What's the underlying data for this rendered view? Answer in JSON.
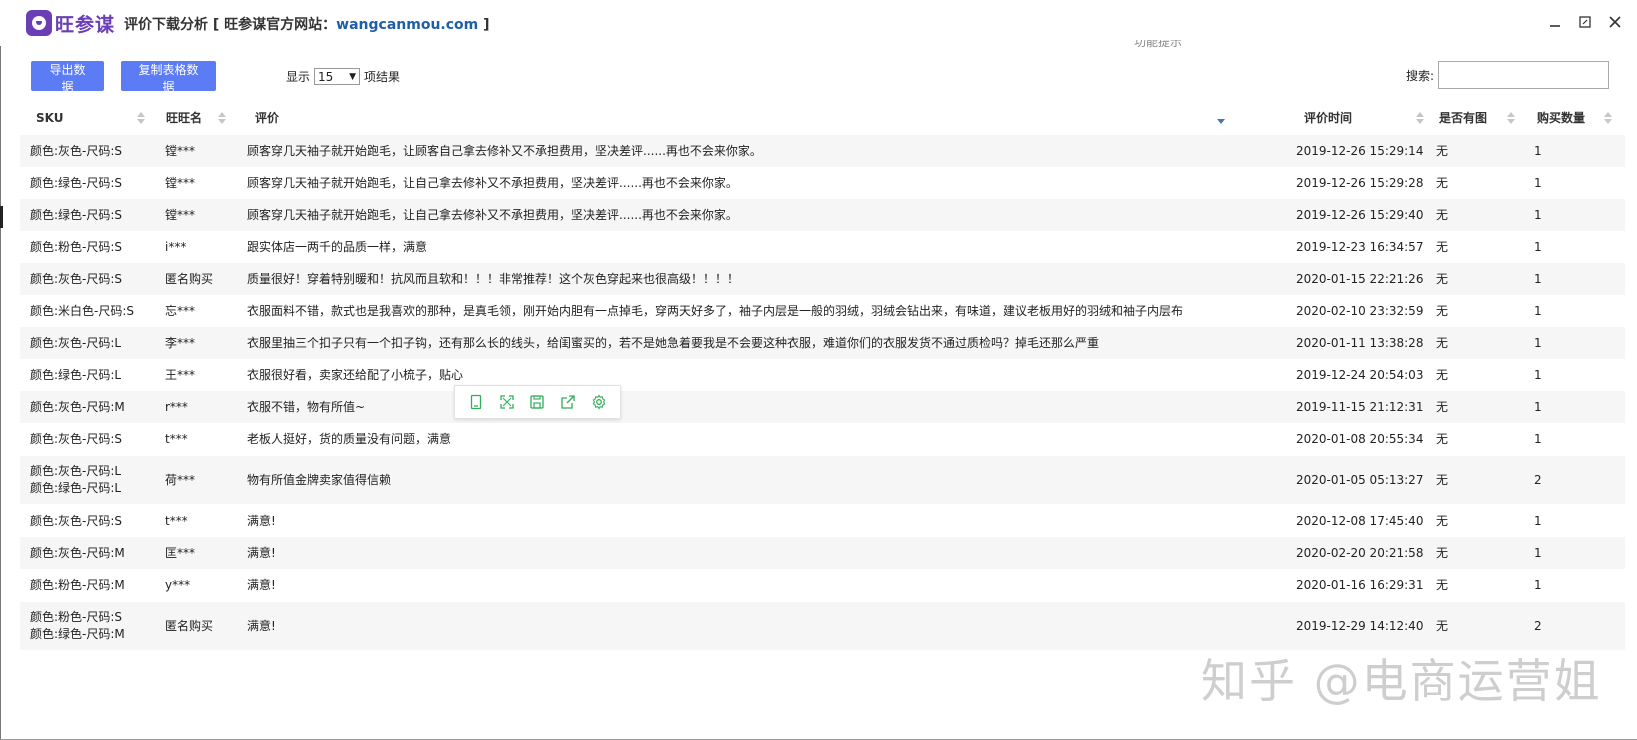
{
  "app": {
    "brand": "旺参谋",
    "title": "评价下载分析",
    "site_prefix": "[ 旺参谋官方网站：",
    "site_url": "wangcanmou.com",
    "site_suffix": " ]"
  },
  "hint": "功能提示",
  "toolbar": {
    "export_label": "导出数据",
    "copy_label": "复制表格数据",
    "show_label": "显示",
    "page_size": "15",
    "results_label": "项结果",
    "search_label": "搜索:"
  },
  "table": {
    "headers": {
      "sku": "SKU",
      "name": "旺旺名",
      "review": "评价",
      "time": "评价时间",
      "pic": "是否有图",
      "qty": "购买数量"
    },
    "rows": [
      {
        "sku": [
          "颜色:灰色-尺码:S"
        ],
        "name": "镗***",
        "review": "顾客穿几天袖子就开始跑毛，让顾客自己拿去修补又不承担费用，坚决差评......再也不会来你家。",
        "time": "2019-12-26 15:29:14",
        "pic": "无",
        "qty": "1"
      },
      {
        "sku": [
          "颜色:绿色-尺码:S"
        ],
        "name": "镗***",
        "review": "顾客穿几天袖子就开始跑毛，让自己拿去修补又不承担费用，坚决差评......再也不会来你家。",
        "time": "2019-12-26 15:29:28",
        "pic": "无",
        "qty": "1"
      },
      {
        "sku": [
          "颜色:绿色-尺码:S"
        ],
        "name": "镗***",
        "review": "顾客穿几天袖子就开始跑毛，让自己拿去修补又不承担费用，坚决差评......再也不会来你家。",
        "time": "2019-12-26 15:29:40",
        "pic": "无",
        "qty": "1"
      },
      {
        "sku": [
          "颜色:粉色-尺码:S"
        ],
        "name": "i***",
        "review": "跟实体店一两千的品质一样，满意",
        "time": "2019-12-23 16:34:57",
        "pic": "无",
        "qty": "1"
      },
      {
        "sku": [
          "颜色:灰色-尺码:S"
        ],
        "name": "匿名购买",
        "review": "质量很好！穿着特别暖和！抗风而且软和！！！非常推荐！这个灰色穿起来也很高级！！！！",
        "time": "2020-01-15 22:21:26",
        "pic": "无",
        "qty": "1"
      },
      {
        "sku": [
          "颜色:米白色-尺码:S"
        ],
        "name": "忘***",
        "review": "衣服面料不错，款式也是我喜欢的那种，是真毛领，刚开始内胆有一点掉毛，穿两天好多了，袖子内层是一般的羽绒，羽绒会钻出来，有味道，建议老板用好的羽绒和袖子内层布",
        "time": "2020-02-10 23:32:59",
        "pic": "无",
        "qty": "1"
      },
      {
        "sku": [
          "颜色:灰色-尺码:L"
        ],
        "name": "李***",
        "review": "衣服里抽三个扣子只有一个扣子钩，还有那么长的线头，给闺蜜买的，若不是她急着要我是不会要这种衣服，难道你们的衣服发货不通过质检吗？掉毛还那么严重",
        "time": "2020-01-11 13:38:28",
        "pic": "无",
        "qty": "1"
      },
      {
        "sku": [
          "颜色:绿色-尺码:L"
        ],
        "name": "王***",
        "review": "衣服很好看，卖家还给配了小梳子，贴心",
        "time": "2019-12-24 20:54:03",
        "pic": "无",
        "qty": "1"
      },
      {
        "sku": [
          "颜色:灰色-尺码:M"
        ],
        "name": "r***",
        "review": "衣服不错，物有所值~",
        "time": "2019-11-15 21:12:31",
        "pic": "无",
        "qty": "1"
      },
      {
        "sku": [
          "颜色:灰色-尺码:S"
        ],
        "name": "t***",
        "review": "老板人挺好，货的质量没有问题，满意",
        "time": "2020-01-08 20:55:34",
        "pic": "无",
        "qty": "1"
      },
      {
        "sku": [
          "颜色:灰色-尺码:L",
          "颜色:绿色-尺码:L"
        ],
        "name": "荷***",
        "review": "物有所值金牌卖家值得信赖",
        "time": "2020-01-05 05:13:27",
        "pic": "无",
        "qty": "2"
      },
      {
        "sku": [
          "颜色:灰色-尺码:S"
        ],
        "name": "t***",
        "review": "满意!",
        "time": "2020-12-08 17:45:40",
        "pic": "无",
        "qty": "1"
      },
      {
        "sku": [
          "颜色:灰色-尺码:M"
        ],
        "name": "匡***",
        "review": "满意!",
        "time": "2020-02-20 20:21:58",
        "pic": "无",
        "qty": "1"
      },
      {
        "sku": [
          "颜色:粉色-尺码:M"
        ],
        "name": "y***",
        "review": "满意!",
        "time": "2020-01-16 16:29:31",
        "pic": "无",
        "qty": "1"
      },
      {
        "sku": [
          "颜色:粉色-尺码:S",
          "颜色:绿色-尺码:M"
        ],
        "name": "匿名购买",
        "review": "满意!",
        "time": "2019-12-29 14:12:40",
        "pic": "无",
        "qty": "2"
      }
    ]
  },
  "watermark": "知乎 @电商运营姐",
  "icons": {
    "float_toolbar": [
      "phone-icon",
      "expand-icon",
      "save-icon",
      "share-icon",
      "settings-icon"
    ],
    "accent": "#5b7cf4",
    "brand_color": "#6a3fb5",
    "tool_color": "#2fae5a"
  }
}
